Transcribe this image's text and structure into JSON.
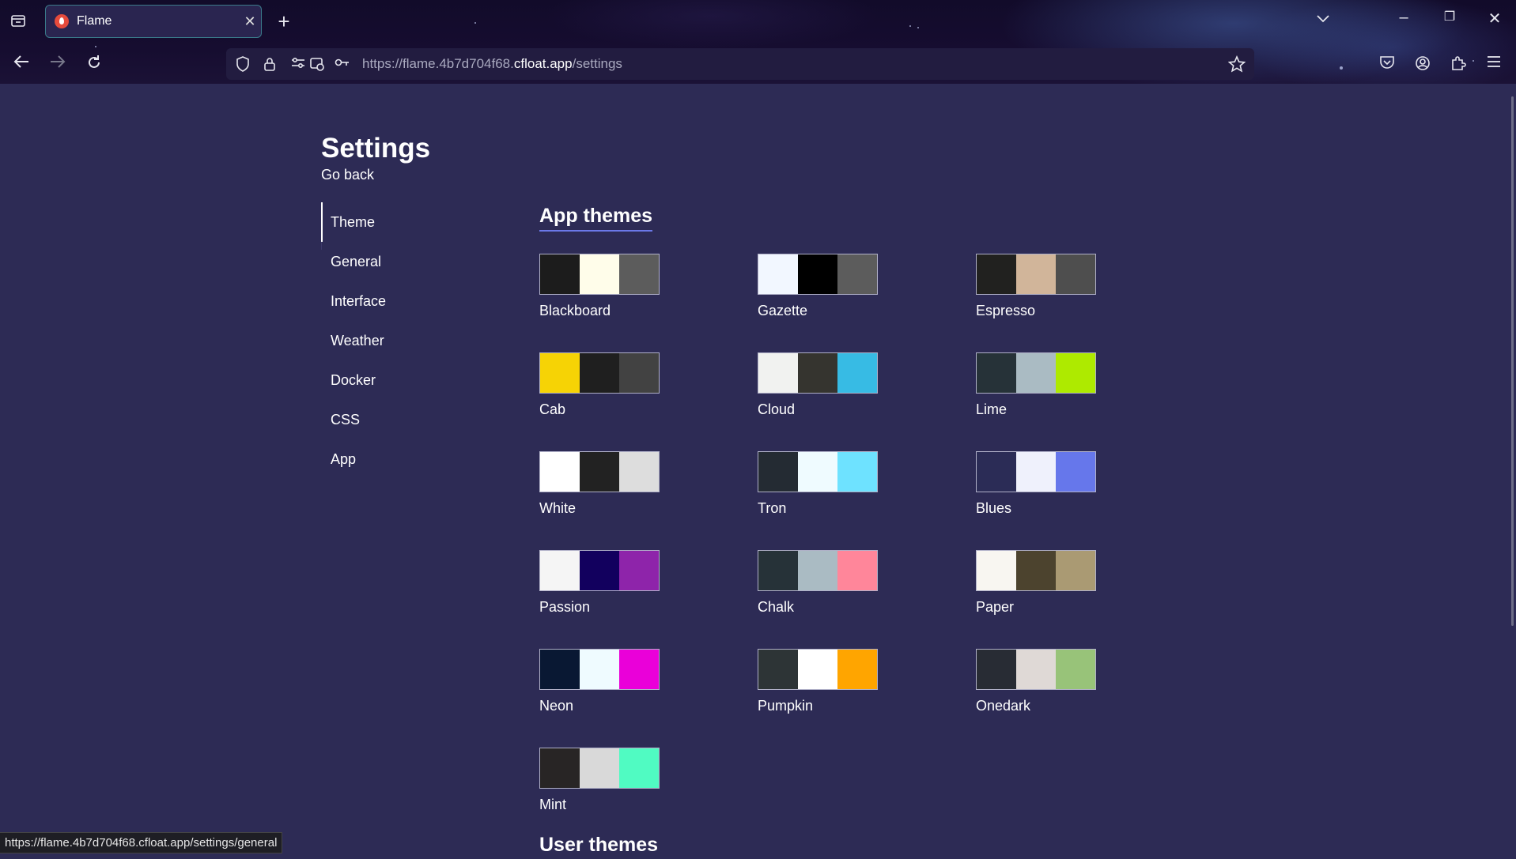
{
  "browser": {
    "tab_title": "Flame",
    "url_scheme_prefix": "https://flame.4b7d704f68.",
    "url_host": "cfloat.app",
    "url_path": "/settings",
    "status_url": "https://flame.4b7d704f68.cfloat.app/settings/general"
  },
  "page": {
    "title": "Settings",
    "go_back": "Go back"
  },
  "nav": {
    "items": [
      {
        "label": "Theme",
        "active": true
      },
      {
        "label": "General"
      },
      {
        "label": "Interface"
      },
      {
        "label": "Weather"
      },
      {
        "label": "Docker"
      },
      {
        "label": "CSS"
      },
      {
        "label": "App"
      }
    ]
  },
  "sections": {
    "app_themes": "App themes",
    "user_themes": "User themes"
  },
  "themes": [
    {
      "name": "Blackboard",
      "colors": [
        "#1c1c1c",
        "#fffdea",
        "#5c5c5c"
      ]
    },
    {
      "name": "Gazette",
      "colors": [
        "#f2f7ff",
        "#000000",
        "#5c5c5c"
      ]
    },
    {
      "name": "Espresso",
      "colors": [
        "#21211f",
        "#d1b59a",
        "#4e4e4e"
      ]
    },
    {
      "name": "Cab",
      "colors": [
        "#f6d305",
        "#1f1f1f",
        "#424242"
      ]
    },
    {
      "name": "Cloud",
      "colors": [
        "#f1f2f0",
        "#35342f",
        "#37bbe4"
      ]
    },
    {
      "name": "Lime",
      "colors": [
        "#263238",
        "#aabbc3",
        "#aeea00"
      ]
    },
    {
      "name": "White",
      "colors": [
        "#ffffff",
        "#222222",
        "#dddddd"
      ]
    },
    {
      "name": "Tron",
      "colors": [
        "#242b33",
        "#effbff",
        "#6ee2ff"
      ]
    },
    {
      "name": "Blues",
      "colors": [
        "#2b2c56",
        "#eff1fc",
        "#6677eb"
      ]
    },
    {
      "name": "Passion",
      "colors": [
        "#f5f5f5",
        "#12005e",
        "#8e24aa"
      ]
    },
    {
      "name": "Chalk",
      "colors": [
        "#263238",
        "#aabbc3",
        "#ff869a"
      ]
    },
    {
      "name": "Paper",
      "colors": [
        "#f8f6f1",
        "#4c432e",
        "#aa9a73"
      ]
    },
    {
      "name": "Neon",
      "colors": [
        "#091833",
        "#effbff",
        "#ea00d9"
      ]
    },
    {
      "name": "Pumpkin",
      "colors": [
        "#2d3436",
        "#ffffff",
        "#ffa500"
      ]
    },
    {
      "name": "Onedark",
      "colors": [
        "#282c34",
        "#dfd9d6",
        "#98c379"
      ]
    },
    {
      "name": "Mint",
      "colors": [
        "#282525",
        "#d9d9d9",
        "#50fbc2"
      ]
    }
  ]
}
